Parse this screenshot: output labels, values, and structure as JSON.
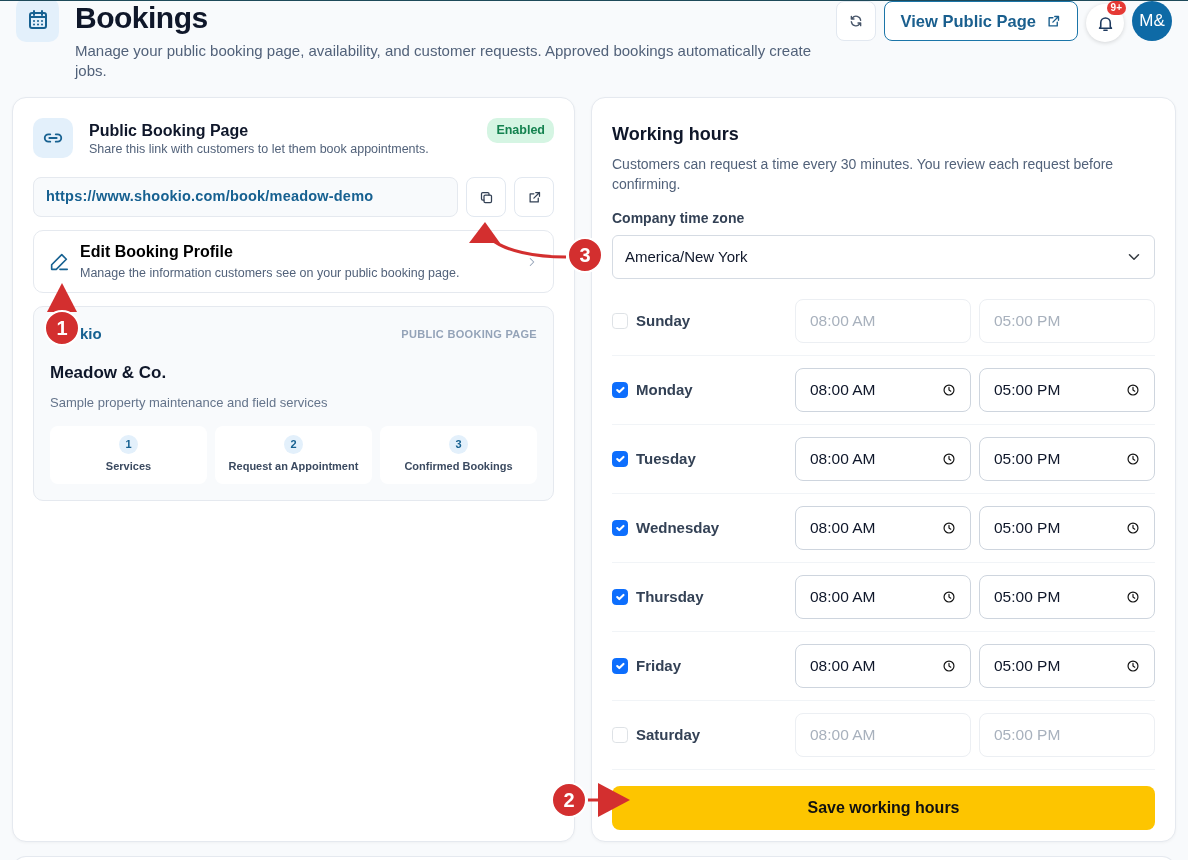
{
  "page_header": {
    "title": "Bookings",
    "subtitle": "Manage your public booking page, availability, and customer requests. Approved bookings automatically create jobs."
  },
  "toolbar": {
    "view_public_page": "View Public Page",
    "notification_count": "9+",
    "avatar": "M&"
  },
  "booking_page_card": {
    "title": "Public Booking Page",
    "description": "Share this link with customers to let them book appointments.",
    "status": "Enabled",
    "enabled": true,
    "url": "https://www.shookio.com/book/meadow-demo",
    "edit_profile": {
      "title": "Edit Booking Profile",
      "description": "Manage the information customers see on your public booking page."
    },
    "preview": {
      "logo": "kio",
      "tag": "PUBLIC BOOKING PAGE",
      "company": "Meadow & Co.",
      "tagline": "Sample property maintenance and field services",
      "steps": [
        {
          "number": "1",
          "label": "Services"
        },
        {
          "number": "2",
          "label": "Request an Appointment"
        },
        {
          "number": "3",
          "label": "Confirmed Bookings"
        }
      ]
    }
  },
  "working_hours": {
    "title": "Working hours",
    "description": "Customers can request a time every 30 minutes. You review each request before confirming.",
    "timezone_label": "Company time zone",
    "timezone": "America/New York",
    "days": [
      {
        "name": "Sunday",
        "checked": false,
        "start": "08:00 AM",
        "end": "05:00 PM"
      },
      {
        "name": "Monday",
        "checked": true,
        "start": "08:00 AM",
        "end": "05:00 PM"
      },
      {
        "name": "Tuesday",
        "checked": true,
        "start": "08:00 AM",
        "end": "05:00 PM"
      },
      {
        "name": "Wednesday",
        "checked": true,
        "start": "08:00 AM",
        "end": "05:00 PM"
      },
      {
        "name": "Thursday",
        "checked": true,
        "start": "08:00 AM",
        "end": "05:00 PM"
      },
      {
        "name": "Friday",
        "checked": true,
        "start": "08:00 AM",
        "end": "05:00 PM"
      },
      {
        "name": "Saturday",
        "checked": false,
        "start": "08:00 AM",
        "end": "05:00 PM"
      }
    ],
    "save_button": "Save working hours"
  },
  "annotations": [
    {
      "label": "1"
    },
    {
      "label": "2"
    },
    {
      "label": "3"
    }
  ]
}
